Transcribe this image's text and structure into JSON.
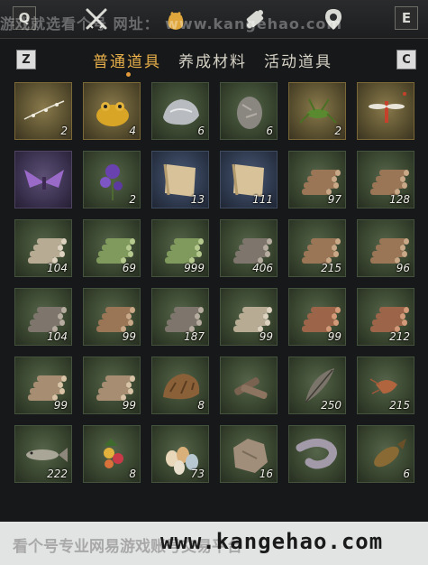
{
  "topbar": {
    "key_left": "Q",
    "key_right": "E",
    "icons": [
      "crossed-swords-icon",
      "pouch-icon",
      "scroll-icon",
      "map-pin-icon"
    ],
    "active_icon": "pouch-icon"
  },
  "watermark_top": "游戏就选看个号 网址： www.kangehao.com",
  "tabs": {
    "key_left": "Z",
    "key_right": "C",
    "items": [
      {
        "label": "普通道具",
        "active": true
      },
      {
        "label": "养成材料",
        "active": false
      },
      {
        "label": "活动道具",
        "active": false
      }
    ]
  },
  "items": [
    {
      "icon": "herb-sprig-icon",
      "count": "2",
      "tone": "gold"
    },
    {
      "icon": "golden-toad-icon",
      "count": "4",
      "tone": "gold"
    },
    {
      "icon": "silver-ore-icon",
      "count": "6",
      "tone": "green"
    },
    {
      "icon": "rock-ore-icon",
      "count": "6",
      "tone": "green"
    },
    {
      "icon": "cricket-icon",
      "count": "2",
      "tone": "gold"
    },
    {
      "icon": "red-dragonfly-icon",
      "count": "",
      "tone": "gold"
    },
    {
      "icon": "purple-moth-icon",
      "count": "",
      "tone": "purple"
    },
    {
      "icon": "purple-flower-icon",
      "count": "2",
      "tone": "green"
    },
    {
      "icon": "scroll-paper-icon",
      "count": "13",
      "tone": "blue"
    },
    {
      "icon": "scroll-paper-icon",
      "count": "111",
      "tone": "blue"
    },
    {
      "icon": "log-bundle-icon",
      "count": "97",
      "tone": "green"
    },
    {
      "icon": "log-bundle-icon",
      "count": "128",
      "tone": "green"
    },
    {
      "icon": "pale-logs-icon",
      "count": "104",
      "tone": "green"
    },
    {
      "icon": "bamboo-bundle-icon",
      "count": "69",
      "tone": "green"
    },
    {
      "icon": "bamboo-bundle-icon",
      "count": "999",
      "tone": "green"
    },
    {
      "icon": "grey-logs-icon",
      "count": "406",
      "tone": "green"
    },
    {
      "icon": "log-bundle-icon",
      "count": "215",
      "tone": "green"
    },
    {
      "icon": "log-bundle-icon",
      "count": "96",
      "tone": "green"
    },
    {
      "icon": "grey-logs-icon",
      "count": "104",
      "tone": "green"
    },
    {
      "icon": "log-bundle-icon",
      "count": "99",
      "tone": "green"
    },
    {
      "icon": "grey-logs-icon",
      "count": "187",
      "tone": "green"
    },
    {
      "icon": "pale-logs-icon",
      "count": "99",
      "tone": "green"
    },
    {
      "icon": "red-logs-icon",
      "count": "99",
      "tone": "green"
    },
    {
      "icon": "red-logs-icon",
      "count": "212",
      "tone": "green"
    },
    {
      "icon": "stacked-logs-icon",
      "count": "99",
      "tone": "green"
    },
    {
      "icon": "stacked-logs-icon",
      "count": "99",
      "tone": "green"
    },
    {
      "icon": "fur-pelt-icon",
      "count": "8",
      "tone": "green"
    },
    {
      "icon": "bark-pieces-icon",
      "count": "",
      "tone": "green"
    },
    {
      "icon": "feather-icon",
      "count": "250",
      "tone": "green"
    },
    {
      "icon": "shrimp-icon",
      "count": "215",
      "tone": "green"
    },
    {
      "icon": "fish-icon",
      "count": "222",
      "tone": "green"
    },
    {
      "icon": "berries-icon",
      "count": "8",
      "tone": "green"
    },
    {
      "icon": "eggs-icon",
      "count": "73",
      "tone": "green"
    },
    {
      "icon": "hide-icon",
      "count": "16",
      "tone": "green"
    },
    {
      "icon": "sea-cucumber-icon",
      "count": "",
      "tone": "green"
    },
    {
      "icon": "carp-icon",
      "count": "6",
      "tone": "green"
    }
  ],
  "watermark_bottom": {
    "text": "看个号专业网易游戏账号交易平台",
    "url": "www.kangehao.com"
  }
}
